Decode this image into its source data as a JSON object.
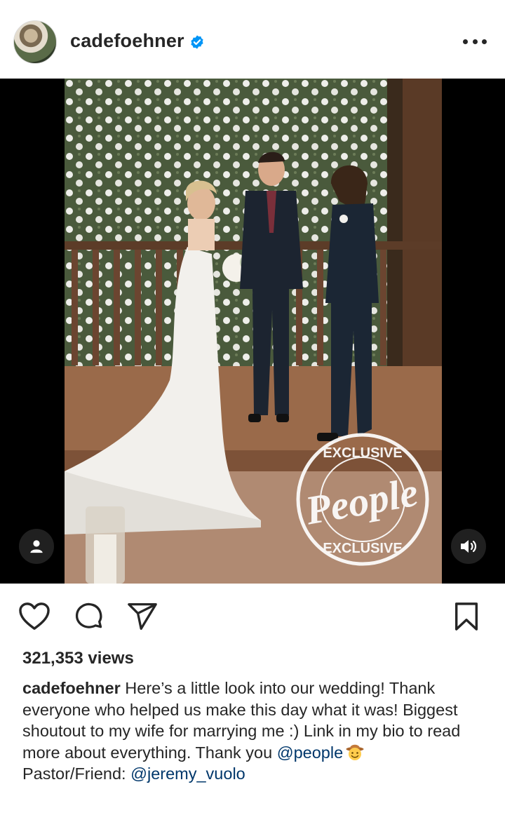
{
  "header": {
    "username": "cadefoehner",
    "verified": true,
    "avatar_icon": "profile-photo",
    "more_icon": "more-horizontal-icon"
  },
  "media": {
    "type": "video",
    "watermark": [
      "EXCLUSIVE",
      "People",
      "EXCLUSIVE"
    ],
    "user_tag_icon": "person-icon",
    "sound_icon": "speaker-icon"
  },
  "actions": {
    "like_icon": "heart-icon",
    "comment_icon": "comment-icon",
    "share_icon": "send-icon",
    "save_icon": "bookmark-icon"
  },
  "stats": {
    "views": "321,353 views"
  },
  "caption": {
    "username": "cadefoehner",
    "text_1": " Here’s a little look into our wedding! Thank everyone who helped us make this day what it was! Biggest shoutout to my wife for marrying me :) Link in my bio to read more about everything. Thank you ",
    "mention_1": "@people",
    "emoji_icon": "cowboy-face-icon",
    "text_2": "Pastor/Friend: ",
    "mention_2": "@jeremy_vuolo"
  },
  "colors": {
    "text": "#262626",
    "link": "#00376b",
    "verified": "#0095f6"
  }
}
